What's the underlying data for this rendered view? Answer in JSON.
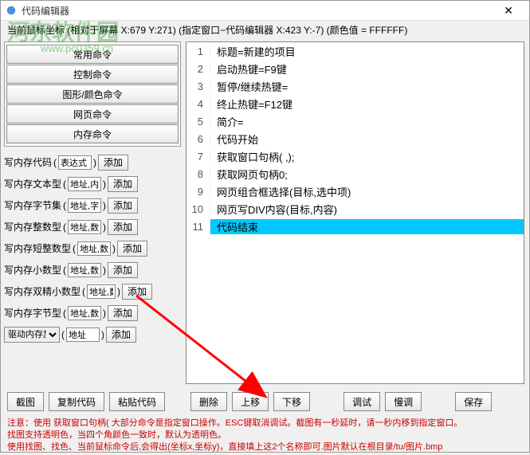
{
  "window": {
    "title": "代码编辑器",
    "close": "✕"
  },
  "coords": "当前鼠标坐标   (相对于屏幕 X:679 Y:271)   (指定窗口−代码编辑器  X:423 Y:-7)   (颜色值 = FFFFFF)",
  "watermark": {
    "text": "河东软件园",
    "url": "www.pc0359.cn"
  },
  "cmdButtons": [
    "常用命令",
    "控制命令",
    "图形/颜色命令",
    "网页命令",
    "内存命令"
  ],
  "memRows": [
    {
      "label": "写内存代码",
      "input": "表达式",
      "btn": "添加"
    },
    {
      "label": "写内存文本型",
      "input": "地址,内",
      "btn": "添加"
    },
    {
      "label": "写内存字节集",
      "input": "地址,字",
      "btn": "添加"
    },
    {
      "label": "写内存整数型",
      "input": "地址,数",
      "btn": "添加"
    },
    {
      "label": "写内存短整数型",
      "input": "地址,数",
      "btn": "添加"
    },
    {
      "label": "写内存小数型",
      "input": "地址,数",
      "btn": "添加"
    },
    {
      "label": "写内存双精小数型",
      "input": "地址,数",
      "btn": "添加"
    },
    {
      "label": "写内存字节型",
      "input": "地址,数",
      "btn": "添加"
    }
  ],
  "driverRow": {
    "select": "驱动内存加",
    "input": "地址",
    "btn": "添加"
  },
  "code": [
    {
      "n": 1,
      "t": "标题=新建的项目"
    },
    {
      "n": 2,
      "t": "启动热键=F9键"
    },
    {
      "n": 3,
      "t": "暂停/继续热键="
    },
    {
      "n": 4,
      "t": "终止热键=F12键"
    },
    {
      "n": 5,
      "t": "简介="
    },
    {
      "n": 6,
      "t": "代码开始"
    },
    {
      "n": 7,
      "t": "获取窗口句柄(                                                                                ,);"
    },
    {
      "n": 8,
      "t": "获取网页句柄0;"
    },
    {
      "n": 9,
      "t": "网页组合框选择(目标,选中项)"
    },
    {
      "n": 10,
      "t": "网页写DIV内容(目标,内容)"
    },
    {
      "n": 11,
      "t": "代码结束",
      "sel": true
    }
  ],
  "bottom": {
    "left": [
      "截图",
      "复制代码",
      "粘贴代码"
    ],
    "right": [
      "删除",
      "上移",
      "下移",
      "调试",
      "慢调",
      "保存"
    ]
  },
  "footer": "注意：使用 获取窗口句柄( 大部分命令是指定窗口操作。ESC键取消调试。截图有一秒延时，请一秒内移到指定窗口。\n找图支持透明色，当四个角颜色一致时，默认为透明色。\n使用找图、找色、当前鼠标命令后,会得出(坐标x,坐标y)，直接填上这2个名称即可.图片默认在根目录/tu/图片.bmp"
}
